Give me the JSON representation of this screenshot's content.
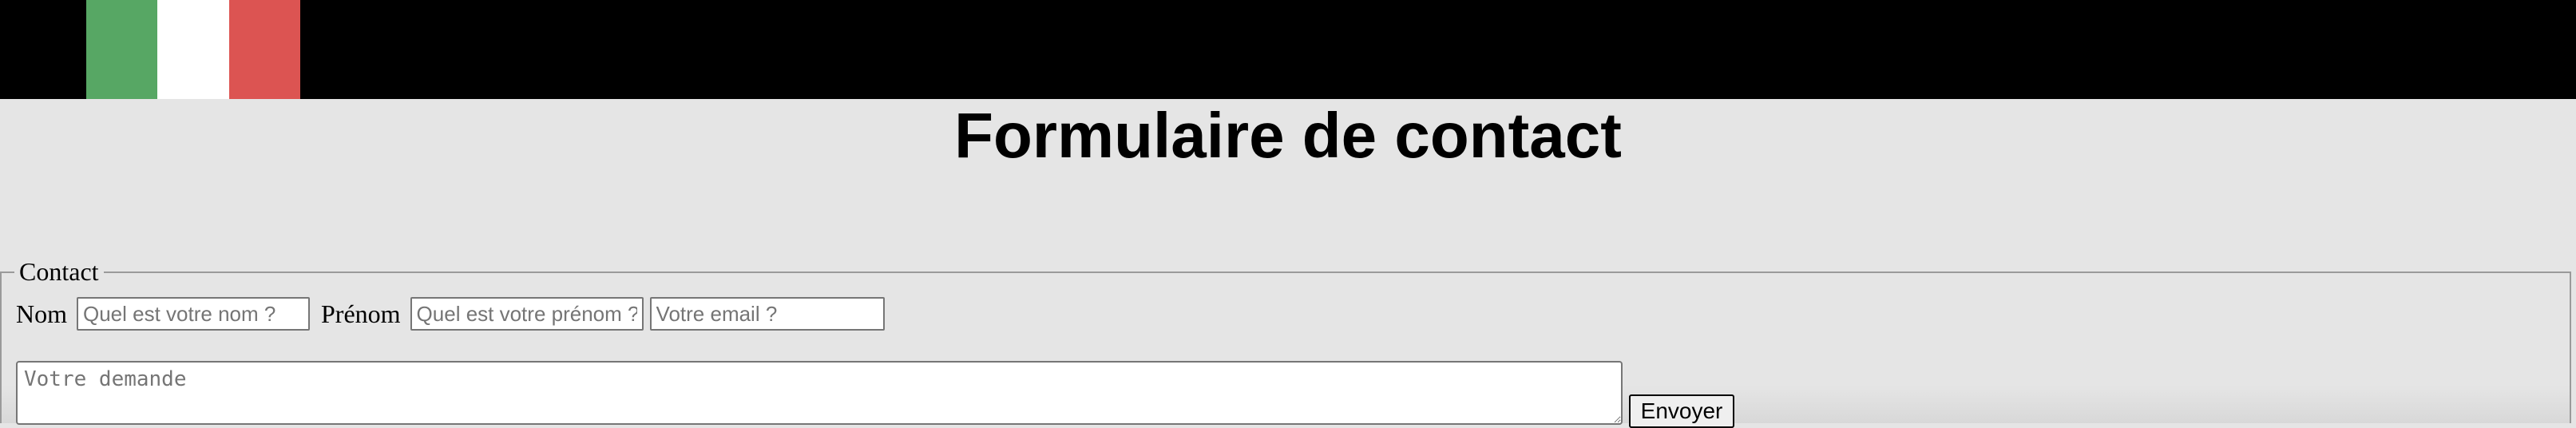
{
  "header": {
    "flag": {
      "name": "italian-flag",
      "colors": [
        "#57a764",
        "#ffffff",
        "#dc5452"
      ]
    }
  },
  "main": {
    "title": "Formulaire de contact"
  },
  "form": {
    "legend": "Contact",
    "nom_label": "Nom",
    "nom_placeholder": "Quel est votre nom ?",
    "prenom_label": "Prénom",
    "prenom_placeholder": "Quel est votre prénom ?",
    "email_placeholder": "Votre email ?",
    "message_placeholder": "Votre demande",
    "submit_label": "Envoyer"
  },
  "colors": {
    "page_bg": "#e5e5e5",
    "header_bg": "#000000"
  }
}
